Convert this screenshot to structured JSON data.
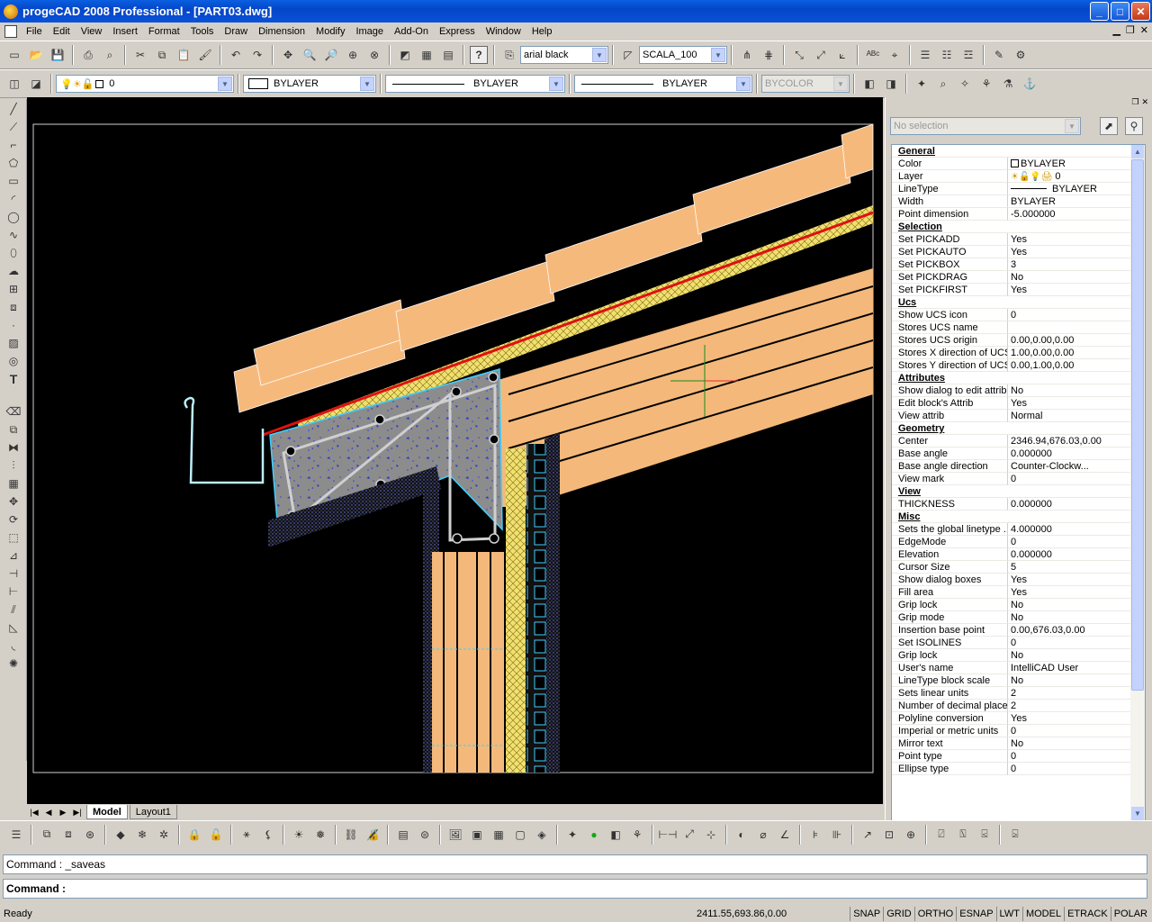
{
  "window": {
    "title": "progeCAD 2008 Professional - [PART03.dwg]",
    "min": "_",
    "max": "□",
    "close": "✕"
  },
  "menu": [
    "File",
    "Edit",
    "View",
    "Insert",
    "Format",
    "Tools",
    "Draw",
    "Dimension",
    "Modify",
    "Image",
    "Add-On",
    "Express",
    "Window",
    "Help"
  ],
  "toolbar": {
    "font": "arial black",
    "scale": "SCALA_100"
  },
  "layerbar": {
    "layer": "0",
    "color": "BYLAYER",
    "linetype": "BYLAYER",
    "lineweight": "BYLAYER",
    "plotstyle": "BYCOLOR"
  },
  "tabs": {
    "model": "Model",
    "layout1": "Layout1"
  },
  "properties": {
    "selection": "No selection",
    "rows": [
      {
        "cat": true,
        "k": "General",
        "v": ""
      },
      {
        "k": "Color",
        "v": "BYLAYER"
      },
      {
        "k": "Layer",
        "v": "0"
      },
      {
        "k": "LineType",
        "v": "BYLAYER"
      },
      {
        "k": "Width",
        "v": "BYLAYER"
      },
      {
        "k": "Point dimension",
        "v": "-5.000000"
      },
      {
        "cat": true,
        "k": "Selection",
        "v": ""
      },
      {
        "k": "Set PICKADD",
        "v": "Yes"
      },
      {
        "k": "Set PICKAUTO",
        "v": "Yes"
      },
      {
        "k": "Set PICKBOX",
        "v": "3"
      },
      {
        "k": "Set PICKDRAG",
        "v": "No"
      },
      {
        "k": "Set PICKFIRST",
        "v": "Yes"
      },
      {
        "cat": true,
        "k": "Ucs",
        "v": ""
      },
      {
        "k": "Show UCS icon",
        "v": "0"
      },
      {
        "k": "Stores UCS name",
        "v": ""
      },
      {
        "k": "Stores UCS origin",
        "v": "0.00,0.00,0.00"
      },
      {
        "k": "Stores X direction of UCS",
        "v": "1.00,0.00,0.00"
      },
      {
        "k": "Stores Y direction of UCS",
        "v": "0.00,1.00,0.00"
      },
      {
        "cat": true,
        "k": "Attributes",
        "v": ""
      },
      {
        "k": "Show dialog to edit attrib",
        "v": "No"
      },
      {
        "k": "Edit block's Attrib",
        "v": "Yes"
      },
      {
        "k": "View attrib",
        "v": "Normal"
      },
      {
        "cat": true,
        "k": "Geometry",
        "v": ""
      },
      {
        "k": "Center",
        "v": "2346.94,676.03,0.00"
      },
      {
        "k": "Base angle",
        "v": "0.000000"
      },
      {
        "k": "Base angle direction",
        "v": "Counter-Clockw..."
      },
      {
        "k": "View mark",
        "v": "0"
      },
      {
        "cat": true,
        "k": "View",
        "v": ""
      },
      {
        "k": "THICKNESS",
        "v": "0.000000"
      },
      {
        "cat": true,
        "k": "Misc",
        "v": ""
      },
      {
        "k": "Sets the global linetype ...",
        "v": "4.000000"
      },
      {
        "k": "EdgeMode",
        "v": "0"
      },
      {
        "k": "Elevation",
        "v": "0.000000"
      },
      {
        "k": "Cursor Size",
        "v": "5"
      },
      {
        "k": "Show dialog boxes",
        "v": "Yes"
      },
      {
        "k": "Fill area",
        "v": "Yes"
      },
      {
        "k": "Grip lock",
        "v": "No"
      },
      {
        "k": "Grip mode",
        "v": "No"
      },
      {
        "k": "Insertion base point",
        "v": "0.00,676.03,0.00"
      },
      {
        "k": "Set ISOLINES",
        "v": "0"
      },
      {
        "k": "Grip lock",
        "v": "No"
      },
      {
        "k": "User's name",
        "v": "IntelliCAD User"
      },
      {
        "k": "LineType block scale",
        "v": "No"
      },
      {
        "k": "Sets linear units",
        "v": "2"
      },
      {
        "k": "Number of decimal places",
        "v": "2"
      },
      {
        "k": "Polyline conversion",
        "v": "Yes"
      },
      {
        "k": "Imperial or metric units",
        "v": "0"
      },
      {
        "k": "Mirror text",
        "v": "No"
      },
      {
        "k": "Point type",
        "v": "0"
      },
      {
        "k": "Ellipse type",
        "v": "0"
      }
    ]
  },
  "command": {
    "history": "Command : _saveas",
    "prompt": "Command :"
  },
  "status": {
    "ready": "Ready",
    "coords": "2411.55,693.86,0.00",
    "toggles": [
      "SNAP",
      "GRID",
      "ORTHO",
      "ESNAP",
      "LWT",
      "MODEL",
      "ETRACK",
      "POLAR"
    ]
  }
}
